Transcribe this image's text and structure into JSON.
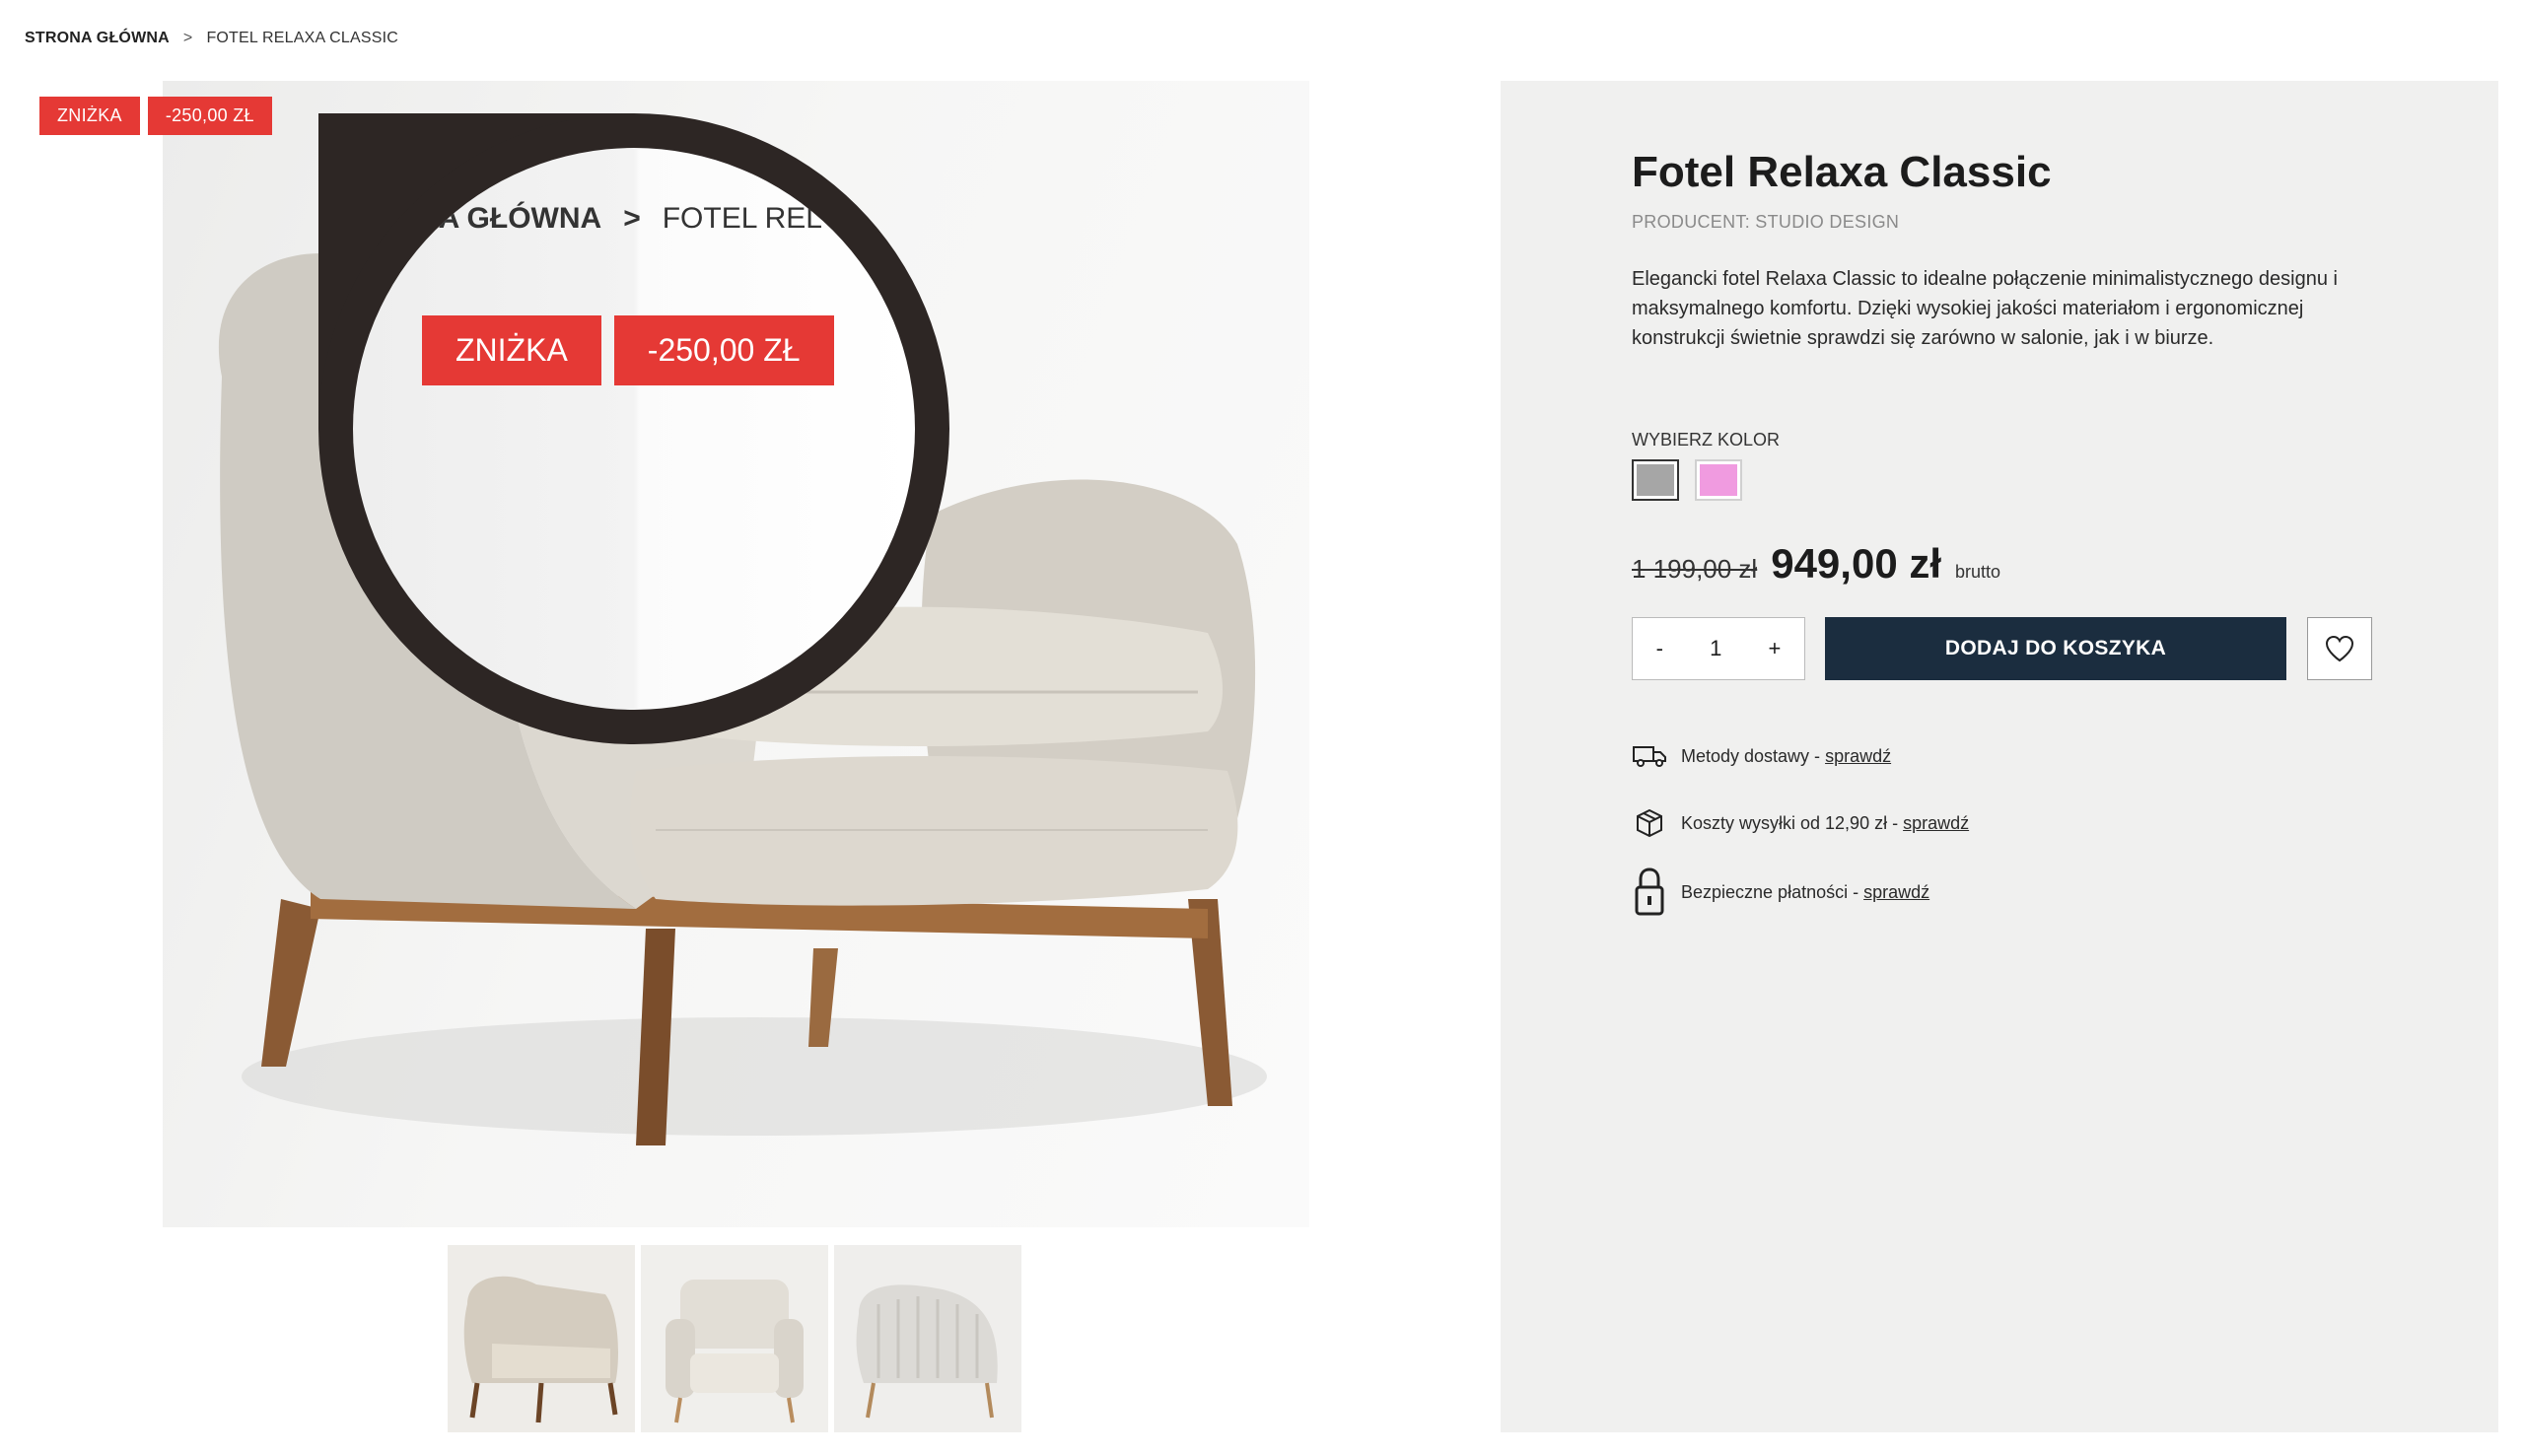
{
  "breadcrumb": {
    "home": "STRONA GŁÓWNA",
    "separator": ">",
    "current": "FOTEL RELAXA CLASSIC"
  },
  "badges": {
    "discount": "ZNIŻKA",
    "amount": "-250,00 ZŁ"
  },
  "zoom": {
    "crumb_home": "RONA GŁÓWNA",
    "crumb_sep": ">",
    "crumb_current": "FOTEL REL",
    "badge_discount": "ZNIŻKA",
    "badge_amount": "-250,00 ZŁ"
  },
  "product": {
    "title": "Fotel Relaxa Classic",
    "producer": "PRODUCENT: STUDIO DESIGN",
    "description": "Elegancki fotel Relaxa Classic to idealne połączenie minimalistycznego designu i maksymalnego komfortu. Dzięki wysokiej jakości materiałom i ergonomicznej konstrukcji świetnie sprawdzi się zarówno w salonie, jak i w biurze.",
    "color_label": "WYBIERZ KOLOR",
    "colors": [
      "#a6a6a6",
      "#f09be0"
    ],
    "old_price": "1 199,00 zł",
    "new_price": "949,00 zł",
    "price_suffix": "brutto"
  },
  "cart": {
    "minus": "-",
    "quantity": "1",
    "plus": "+",
    "add_label": "DODAJ DO KOSZYKA"
  },
  "info": [
    {
      "icon": "truck-icon",
      "text": "Metody dostawy - ",
      "link": "sprawdź"
    },
    {
      "icon": "box-icon",
      "text": "Koszty wysyłki od 12,90 zł - ",
      "link": "sprawdź"
    },
    {
      "icon": "lock-icon",
      "text": "Bezpieczne płatności - ",
      "link": "sprawdź"
    }
  ],
  "colors": {
    "accent_red": "#e53935",
    "button_dark": "#1b2d3f",
    "panel_bg": "#f0f0ef"
  }
}
